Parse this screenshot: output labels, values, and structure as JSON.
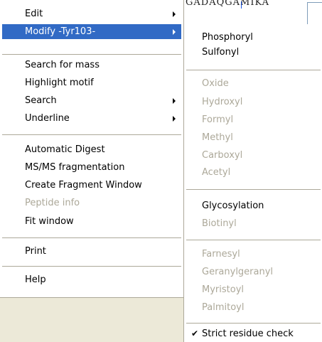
{
  "background_window": {
    "sequence_text": "GADAQGAMIKA"
  },
  "main_menu": {
    "edit": "Edit",
    "modify": "Modify -Tyr103-",
    "search_for_mass": "Search for mass",
    "highlight_motif": "Highlight motif",
    "search": "Search",
    "underline": "Underline",
    "automatic_digest": "Automatic Digest",
    "msms_fragmentation": "MS/MS fragmentation",
    "create_fragment_window": "Create Fragment Window",
    "peptide_info": "Peptide info",
    "fit_window": "Fit window",
    "print": "Print",
    "help": "Help"
  },
  "submenu": {
    "phosphoryl": "Phosphoryl",
    "sulfonyl": "Sulfonyl",
    "oxide": "Oxide",
    "hydroxyl": "Hydroxyl",
    "formyl": "Formyl",
    "methyl": "Methyl",
    "carboxyl": "Carboxyl",
    "acetyl": "Acetyl",
    "glycosylation": "Glycosylation",
    "biotinyl": "Biotinyl",
    "farnesyl": "Farnesyl",
    "geranylgeranyl": "Geranylgeranyl",
    "myristoyl": "Myristoyl",
    "palmitoyl": "Palmitoyl",
    "strict_residue_check": "Strict residue check",
    "check_mark": "✔"
  },
  "colors": {
    "highlight": "#316ac5",
    "disabled_text": "#aca899",
    "menu_bg": "#ffffff",
    "desktop_bg": "#ece9d8"
  }
}
